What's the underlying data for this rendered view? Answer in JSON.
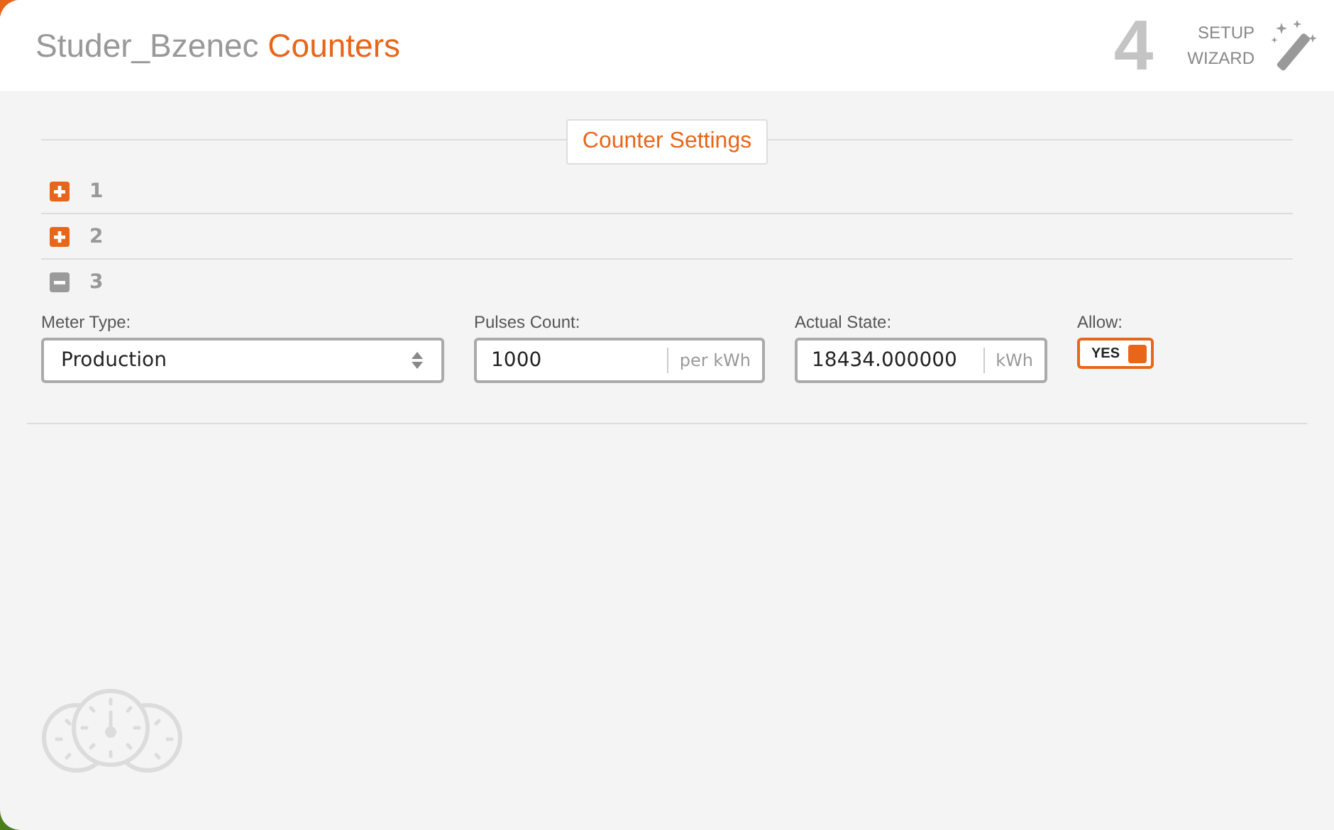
{
  "header": {
    "title": "Studer_Bzenec",
    "title_accent": "Counters",
    "step": "4",
    "wizard_lines": [
      "SETUP",
      "WIZARD"
    ]
  },
  "section_title": "Counter Settings",
  "counters": [
    {
      "label": "1",
      "expanded": false
    },
    {
      "label": "2",
      "expanded": false
    },
    {
      "label": "3",
      "expanded": true,
      "fields": [
        {
          "kind": "select",
          "label": "Meter Type:",
          "value": "Production"
        },
        {
          "kind": "unit",
          "label": "Pulses Count:",
          "value": "1000",
          "unit": "per kWh"
        },
        {
          "kind": "unit",
          "label": "Actual State:",
          "value": "18434.000000",
          "unit": "kWh"
        },
        {
          "kind": "toggle",
          "label": "Allow:",
          "text": "YES",
          "on": true
        }
      ]
    }
  ]
}
